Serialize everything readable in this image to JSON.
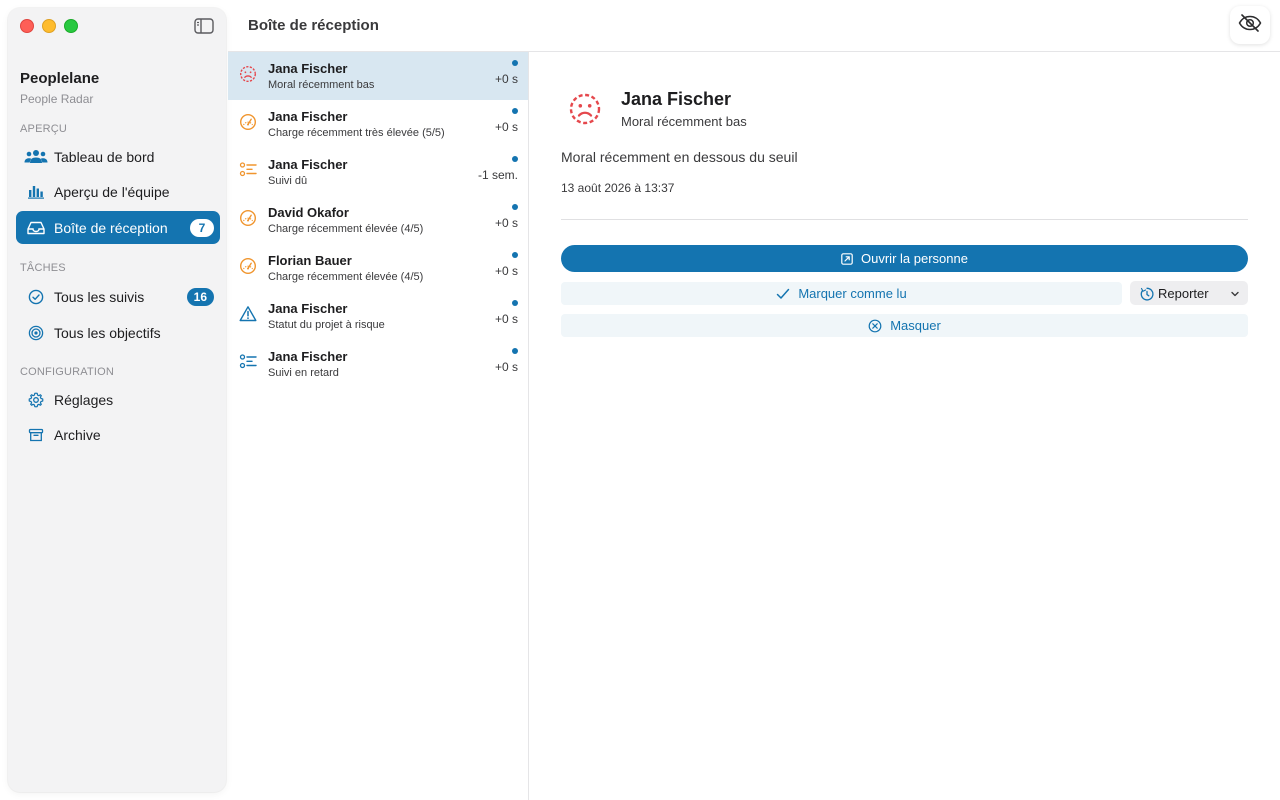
{
  "app": {
    "name": "Peoplelane",
    "subtitle": "People Radar"
  },
  "sidebar": {
    "sections": [
      {
        "label": "APERÇU"
      },
      {
        "label": "TÂCHES"
      },
      {
        "label": "CONFIGURATION"
      }
    ],
    "items": [
      {
        "label": "Tableau de bord",
        "icon": "people-icon"
      },
      {
        "label": "Aperçu de l'équipe",
        "icon": "bar-chart-icon"
      },
      {
        "label": "Boîte de réception",
        "icon": "inbox-icon",
        "badge": "7",
        "active": true
      },
      {
        "label": "Tous les suivis",
        "icon": "check-circle-icon",
        "badge": "16"
      },
      {
        "label": "Tous les objectifs",
        "icon": "target-icon"
      },
      {
        "label": "Réglages",
        "icon": "gear-icon"
      },
      {
        "label": "Archive",
        "icon": "archive-box-icon"
      }
    ]
  },
  "header": {
    "title": "Boîte de réception",
    "toggle_icon": "eye-slash-icon"
  },
  "messages": [
    {
      "name": "Jana Fischer",
      "subtitle": "Moral récemment bas",
      "time": "+0 s",
      "icon": "sad-face-icon",
      "unread": true,
      "selected": true
    },
    {
      "name": "Jana Fischer",
      "subtitle": "Charge récemment très élevée (5/5)",
      "time": "+0 s",
      "icon": "gauge-icon",
      "unread": true
    },
    {
      "name": "Jana Fischer",
      "subtitle": "Suivi dû",
      "time": "-1 sem.",
      "icon": "checklist-icon",
      "unread": true
    },
    {
      "name": "David Okafor",
      "subtitle": "Charge récemment élevée (4/5)",
      "time": "+0 s",
      "icon": "gauge-icon",
      "unread": true
    },
    {
      "name": "Florian Bauer",
      "subtitle": "Charge récemment élevée (4/5)",
      "time": "+0 s",
      "icon": "gauge-icon",
      "unread": true
    },
    {
      "name": "Jana Fischer",
      "subtitle": "Statut du projet à risque",
      "time": "+0 s",
      "icon": "warning-triangle-icon",
      "unread": true
    },
    {
      "name": "Jana Fischer",
      "subtitle": "Suivi en retard",
      "time": "+0 s",
      "icon": "checklist-icon",
      "unread": true
    }
  ],
  "detail": {
    "name": "Jana Fischer",
    "subtitle": "Moral récemment bas",
    "description": "Moral récemment en dessous du seuil",
    "date": "13 août 2026 à 13:37",
    "actions": {
      "open": "Ouvrir la personne",
      "mark_read": "Marquer comme lu",
      "snooze": "Reporter",
      "hide": "Masquer"
    }
  },
  "colors": {
    "accent": "#1474b0",
    "orange": "#f0952e",
    "red": "#e5484d",
    "sidebar_bg": "#f3f3f4",
    "selected_row": "#d8e7f1"
  }
}
